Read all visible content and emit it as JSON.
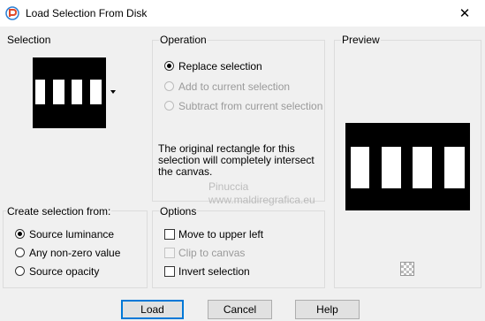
{
  "window": {
    "title": "Load Selection From Disk",
    "close_icon": "close-icon"
  },
  "selection": {
    "title": "Selection"
  },
  "operation": {
    "title": "Operation",
    "options": [
      {
        "label": "Replace selection",
        "checked": true,
        "disabled": false
      },
      {
        "label": "Add to current selection",
        "checked": false,
        "disabled": true
      },
      {
        "label": "Subtract from current selection",
        "checked": false,
        "disabled": true
      }
    ],
    "info_line1": "The original rectangle for this",
    "info_line2": "selection will completely intersect",
    "info_line3": "the canvas."
  },
  "preview": {
    "title": "Preview"
  },
  "create_from": {
    "title": "Create selection from:",
    "options": [
      {
        "label": "Source luminance",
        "checked": true
      },
      {
        "label": "Any non-zero value",
        "checked": false
      },
      {
        "label": "Source opacity",
        "checked": false
      }
    ]
  },
  "options": {
    "title": "Options",
    "items": [
      {
        "label": "Move to upper left",
        "checked": false,
        "disabled": false
      },
      {
        "label": "Clip to canvas",
        "checked": false,
        "disabled": true
      },
      {
        "label": "Invert selection",
        "checked": false,
        "disabled": false
      }
    ]
  },
  "buttons": {
    "load": "Load",
    "cancel": "Cancel",
    "help": "Help"
  },
  "watermark": {
    "name": "Pinuccia",
    "site": "www.maldiregrafica.eu"
  }
}
